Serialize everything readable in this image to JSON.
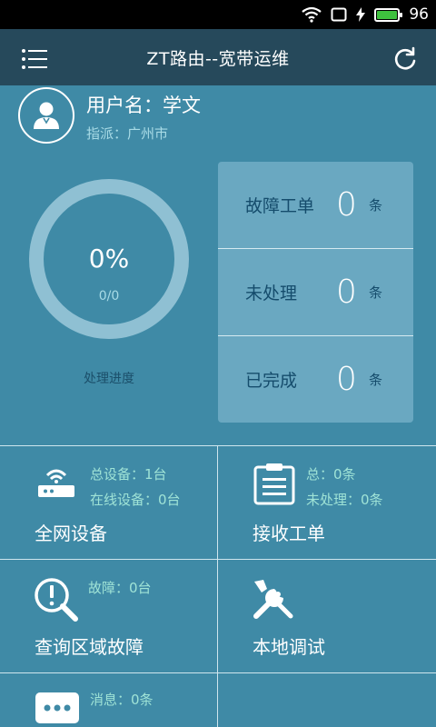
{
  "status_bar": {
    "battery_level": "96",
    "icons": [
      "wifi-icon",
      "screen-icon",
      "charging-icon",
      "battery-icon"
    ]
  },
  "header": {
    "title": "ZT路由--宽带运维",
    "left_icon": "menu-icon",
    "right_icon": "refresh-icon"
  },
  "user": {
    "name_line": "用户名：学文",
    "assign_line": "指派：广州市"
  },
  "progress": {
    "percent_text": "0%",
    "count_text": "0/0",
    "label": "处理进度",
    "value": 0
  },
  "stats": [
    {
      "label": "故障工单",
      "value": "0",
      "unit": "条"
    },
    {
      "label": "未处理",
      "value": "0",
      "unit": "条"
    },
    {
      "label": "已完成",
      "value": "0",
      "unit": "条"
    }
  ],
  "tiles": {
    "network": {
      "title": "全网设备",
      "sub1": "总设备：1台",
      "sub2": "在线设备：0台",
      "icon": "router-icon"
    },
    "orders": {
      "title": "接收工单",
      "sub1": "总：0条",
      "sub2": "未处理：0条",
      "icon": "clipboard-icon"
    },
    "query": {
      "title": "查询区域故障",
      "sub1": "故障：0台",
      "icon": "magnifier-alert-icon"
    },
    "debug": {
      "title": "本地调试",
      "icon": "tools-icon"
    },
    "messages": {
      "sub1": "消息：0条",
      "icon": "chat-icon"
    }
  },
  "colors": {
    "background": "#3f8aa6",
    "header": "#26495b",
    "panel": "#6aa8c1",
    "accent_text": "#9fe3d6"
  }
}
